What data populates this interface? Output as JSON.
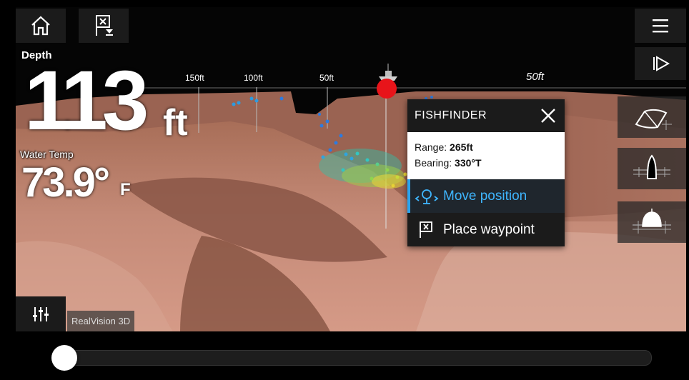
{
  "top_bar": {
    "home_icon": "home-icon",
    "waypoint_icon": "waypoint-flag-icon",
    "menu_icon": "hamburger-menu-icon",
    "forward_icon": "play-forward-icon"
  },
  "data_overlay": {
    "depth_label": "Depth",
    "depth_value": "113",
    "depth_unit": "ft",
    "temp_label": "Water Temp",
    "temp_value": "73.9°",
    "temp_unit": "F"
  },
  "range_markers": [
    "150ft",
    "100ft",
    "50ft",
    "50ft"
  ],
  "popup": {
    "title": "FISHFINDER",
    "range_label": "Range:",
    "range_value": "265ft",
    "bearing_label": "Bearing:",
    "bearing_value": "330°T",
    "move_position": "Move position",
    "place_waypoint": "Place waypoint"
  },
  "view_buttons": [
    "iso-view-icon",
    "rear-view-icon",
    "front-view-icon"
  ],
  "bottom": {
    "settings_icon": "sliders-settings-icon",
    "app_label": "RealVision 3D",
    "slider_position": 0.0
  },
  "colors": {
    "accent": "#3fb6ff",
    "terrain": "#c88a78",
    "marker": "#e8141a"
  }
}
